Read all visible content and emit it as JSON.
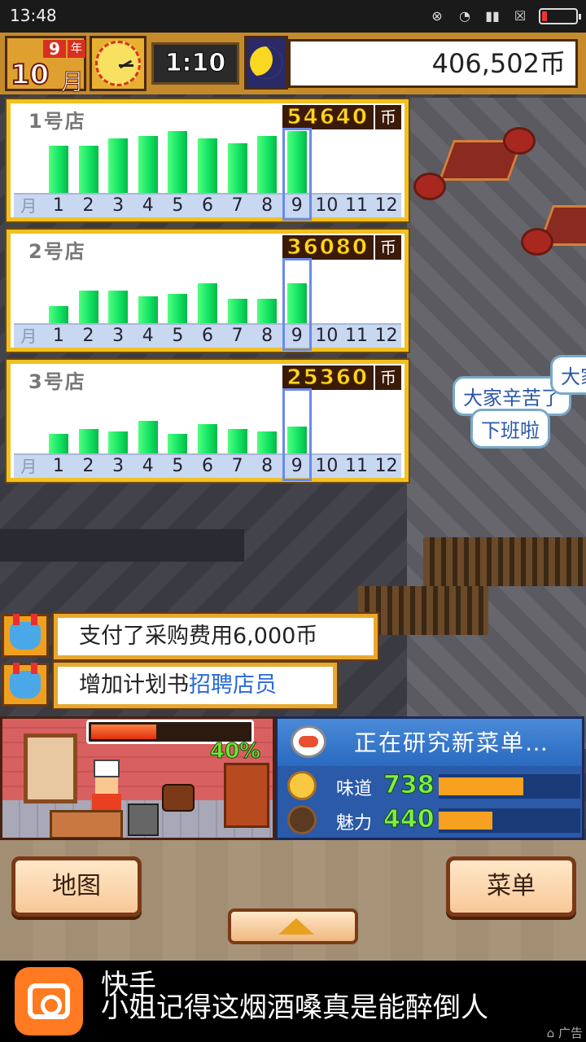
{
  "status_bar": {
    "time": "13:48"
  },
  "hud": {
    "year_num": "9",
    "year_label": "年",
    "month_num": "10",
    "month_label": "月",
    "time": "1:10",
    "coins": "406,502币"
  },
  "chart_data": [
    {
      "type": "bar",
      "title": "1号店",
      "total": "54640",
      "currency": "币",
      "axis_label": "月",
      "categories": [
        "1",
        "2",
        "3",
        "4",
        "5",
        "6",
        "7",
        "8",
        "9",
        "10",
        "11",
        "12"
      ],
      "values": [
        0.76,
        0.76,
        0.88,
        0.92,
        1.0,
        0.88,
        0.8,
        0.92,
        1.0,
        null,
        null,
        null
      ],
      "selected_month": "9"
    },
    {
      "type": "bar",
      "title": "2号店",
      "total": "36080",
      "currency": "币",
      "axis_label": "月",
      "categories": [
        "1",
        "2",
        "3",
        "4",
        "5",
        "6",
        "7",
        "8",
        "9",
        "10",
        "11",
        "12"
      ],
      "values": [
        0.28,
        0.52,
        0.52,
        0.44,
        0.48,
        0.64,
        0.4,
        0.4,
        0.64,
        null,
        null,
        null
      ],
      "selected_month": "9"
    },
    {
      "type": "bar",
      "title": "3号店",
      "total": "25360",
      "currency": "币",
      "axis_label": "月",
      "categories": [
        "1",
        "2",
        "3",
        "4",
        "5",
        "6",
        "7",
        "8",
        "9",
        "10",
        "11",
        "12"
      ],
      "values": [
        0.32,
        0.4,
        0.36,
        0.52,
        0.32,
        0.48,
        0.4,
        0.36,
        0.44,
        null,
        null,
        null
      ],
      "selected_month": "9"
    }
  ],
  "messages": [
    {
      "text": "支付了采购费用6,000币"
    },
    {
      "text_prefix": "增加计划书",
      "link": "招聘店员"
    }
  ],
  "bubbles": {
    "b1": "大家辛苦了",
    "b2": "下班啦",
    "b3": "大家"
  },
  "kitchen": {
    "progress_pct": "40%",
    "progress": 0.4
  },
  "research": {
    "title": "正在研究新菜单…",
    "stats": [
      {
        "label": "味道",
        "value": "738",
        "level": 0.6
      },
      {
        "label": "魅力",
        "value": "440",
        "level": 0.38
      }
    ]
  },
  "controls": {
    "map_label": "地图",
    "menu_label": "菜单"
  },
  "ad": {
    "brand": "快手",
    "slogan": "小姐记得这烟酒嗓真是能醉倒人",
    "tag": "广告"
  }
}
